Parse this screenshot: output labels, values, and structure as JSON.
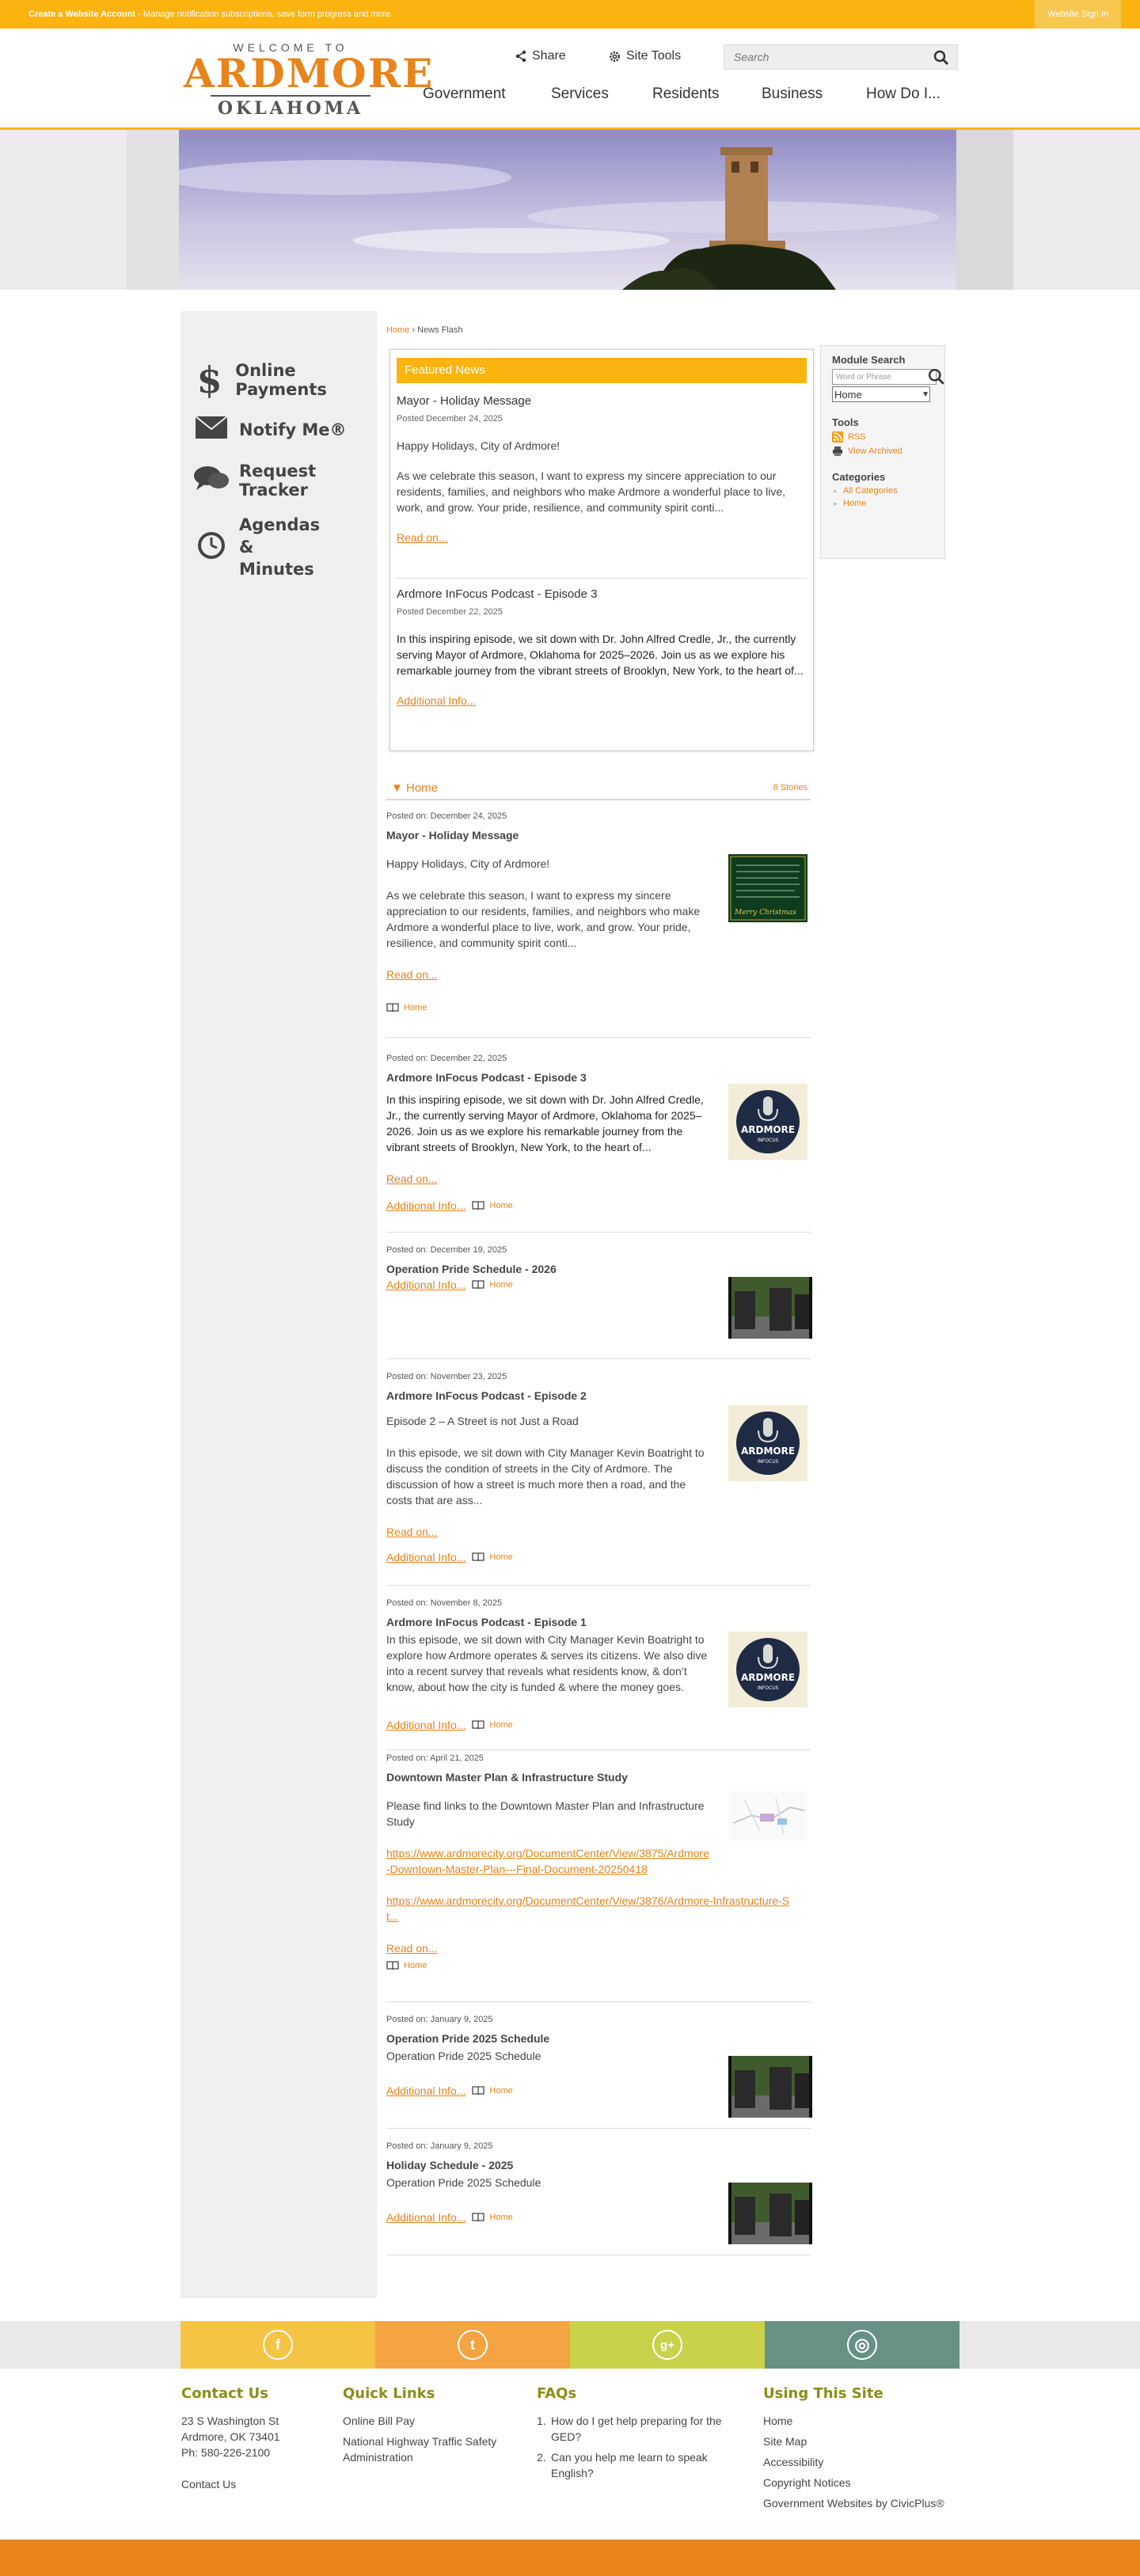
{
  "topbar": {
    "create_link": "Create a Website Account",
    "create_rest": " - Manage notification subscriptions, save form progress and more.",
    "signin": "Website Sign In"
  },
  "logo": {
    "welcome": "WELCOME TO",
    "city": "ARDMORE",
    "state": "OKLAHOMA"
  },
  "tools": {
    "share": "Share",
    "site_tools": "Site Tools"
  },
  "search": {
    "placeholder": "Search"
  },
  "nav": [
    "Government",
    "Services",
    "Residents",
    "Business",
    "How Do I..."
  ],
  "quick_links": [
    "Online Payments",
    "Notify Me®",
    "Request Tracker",
    "Agendas & Minutes"
  ],
  "breadcrumb": {
    "home": "Home",
    "sep": " › ",
    "current": "News Flash"
  },
  "featured": {
    "title": "Featured News",
    "items": [
      {
        "title": "Mayor - Holiday Message",
        "date": "Posted December 24, 2025",
        "greeting": "Happy Holidays, City of Ardmore!",
        "text": "As we celebrate this season, I want to express my sincere appreciation to our residents, families, and neighbors who make Ardmore a wonderful place to live, work, and grow. Your pride, resilience, and community spirit conti...",
        "link": "Read on..."
      },
      {
        "title": "Ardmore InFocus Podcast - Episode 3",
        "date": "Posted December 22, 2025",
        "text": "In this inspiring episode, we sit down with Dr. John Alfred Credle, Jr., the currently serving Mayor of Ardmore, Oklahoma for 2025–2026. Join us as we explore his remarkable journey from the vibrant streets of Brooklyn, New York, to the heart of...",
        "link": "Additional Info..."
      }
    ]
  },
  "category_bar": {
    "title": "Home",
    "count": "8 Stories"
  },
  "stories": [
    {
      "posted": "Posted on: December 24, 2025",
      "title": "Mayor - Holiday Message",
      "p1": "Happy Holidays, City of Ardmore!",
      "p2": "As we celebrate this season, I want to express my sincere appreciation to our residents, families, and neighbors who make Ardmore a wonderful place to live, work, and grow. Your pride, resilience, and community spirit conti...",
      "read": "Read on...",
      "category": "Home"
    },
    {
      "posted": "Posted on: December 22, 2025",
      "title": "Ardmore InFocus Podcast - Episode 3",
      "p1": "In this inspiring episode, we sit down with Dr. John Alfred Credle, Jr., the currently serving Mayor of Ardmore, Oklahoma for 2025–2026. Join us as we explore his remarkable journey from the vibrant streets of Brooklyn, New York, to the heart of...",
      "read": "Read on...",
      "info": "Additional Info...",
      "category": "Home",
      "thumb_text": "ARDMORE",
      "thumb_sub": "INFOCUS"
    },
    {
      "posted": "Posted on: December 19, 2025",
      "title": "Operation Pride Schedule - 2026",
      "info": "Additional Info...",
      "category": "Home"
    },
    {
      "posted": "Posted on: November 23, 2025",
      "title": "Ardmore InFocus Podcast - Episode 2",
      "p1": "Episode 2 – A Street is not Just a Road",
      "p2": "In this episode, we sit down with City Manager Kevin Boatright to discuss the condition of streets in the City of Ardmore. The discussion of how a street is much more then a road, and the costs that are ass...",
      "read": "Read on...",
      "info": "Additional Info...",
      "category": "Home"
    },
    {
      "posted": "Posted on: November 8, 2025",
      "title": "Ardmore InFocus Podcast - Episode 1",
      "p1": "In this episode, we sit down with City Manager Kevin Boatright to explore how Ardmore operates & serves its citizens. We also dive into a recent survey that reveals what residents know, & don’t know, about how the city is funded & where the money goes.",
      "info": "Additional Info...",
      "category": "Home"
    },
    {
      "posted": "Posted on: April 21, 2025",
      "title": "Downtown Master Plan & Infrastructure Study",
      "p1": "Please find links to the Downtown Master Plan and Infrastructure Study",
      "url1": "https://www.ardmorecity.org/DocumentCenter/View/3875/Ardmore-Downtown-Master-Plan---Final-Document-20250418",
      "url2": "https://www.ardmorecity.org/DocumentCenter/View/3876/Ardmore-Infrastructure-St...",
      "read": "Read on...",
      "category": "Home"
    },
    {
      "posted": "Posted on: January 9, 2025",
      "title": "Operation Pride 2025 Schedule",
      "p1": "Operation Pride 2025 Schedule",
      "info": "Additional Info...",
      "category": "Home"
    },
    {
      "posted": "Posted on: January 9, 2025",
      "title": "Holiday Schedule - 2025",
      "p1": "Operation Pride 2025 Schedule",
      "info": "Additional Info...",
      "category": "Home"
    }
  ],
  "xmas_text": "Merry Christmas",
  "right": {
    "module_search": "Module Search",
    "search_placeholder": "Word or Phrase",
    "select_value": "Home",
    "tools": "Tools",
    "rss": "RSS",
    "archived": "View Archived",
    "categories": "Categories",
    "cat_items": [
      "All Categories",
      "Home"
    ]
  },
  "social": [
    {
      "name": "facebook",
      "glyph": "f",
      "color": "#f6c445"
    },
    {
      "name": "twitter",
      "glyph": "t",
      "color": "#f4a443"
    },
    {
      "name": "google-plus",
      "glyph": "g+",
      "color": "#c9d24a"
    },
    {
      "name": "instagram",
      "glyph": "◎",
      "color": "#679184"
    }
  ],
  "footer": {
    "contact": {
      "heading": "Contact Us",
      "addr1": "23 S Washington St",
      "addr2": "Ardmore, OK 73401",
      "phone": "Ph: 580-226-2100",
      "link": "Contact Us"
    },
    "quick": {
      "heading": "Quick Links",
      "items": [
        "Online Bill Pay",
        "National Highway Traffic Safety Administration"
      ]
    },
    "faqs": {
      "heading": "FAQs",
      "items": [
        "How do I get help preparing for the GED?",
        "Can you help me learn to speak English?"
      ]
    },
    "using": {
      "heading": "Using This Site",
      "items": [
        "Home",
        "Site Map",
        "Accessibility",
        "Copyright Notices",
        "Government Websites by CivicPlus®"
      ]
    }
  }
}
